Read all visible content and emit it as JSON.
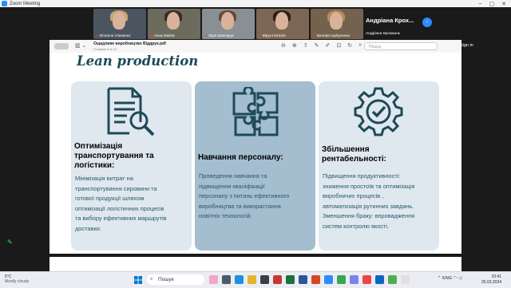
{
  "window": {
    "app_title": "Zoom Meeting"
  },
  "participants": [
    {
      "name": "Віталіна Ульванко",
      "bg": "#4a5560",
      "hair": "#c9a571"
    },
    {
      "name": "Анна Майов",
      "bg": "#6d6a5e",
      "hair": "#3b2a22"
    },
    {
      "name": "Лідія Шевчарук",
      "bg": "#8a8f93",
      "hair": "#6a4a34"
    },
    {
      "name": "Вірук Наталія",
      "bg": "#7c6656",
      "hair": "#2a1f1a"
    },
    {
      "name": "Валерія Цибуленко",
      "bg": "#74624f",
      "hair": "#b88a5a"
    }
  ],
  "current_user": {
    "big_name": "Андріана Крох...",
    "small_name": "Андріана Крохмаль"
  },
  "viewer": {
    "doc_title": "Ощадливе виробництво Віддрук.pdf",
    "page_info": "Сторінка 6 із 12",
    "search_placeholder": "Пошук",
    "sign_in": "Sign in"
  },
  "slide": {
    "title": "Lean production",
    "cards": [
      {
        "heading": [
          "Оптимізація",
          "транспортування та",
          "логістики:"
        ],
        "body": [
          "Мінімізація витрат на",
          "транспортування сировини та",
          "готової продукції шляхом",
          "оптимізації логістичних процесів",
          "та вибору ефективних маршрутів",
          "доставки."
        ]
      },
      {
        "heading": [
          "Навчання персоналу:"
        ],
        "body": [
          "Проведення навчання та",
          "підвищення кваліфікації",
          "персоналу з питань ефективного",
          "виробництва та використання",
          "новітніх технологій."
        ]
      },
      {
        "heading": [
          "Збільшення",
          "рентабельності:"
        ],
        "body": [
          "Підвищення продуктивності:",
          "зниження простоїв та оптимізація",
          "виробничих процесів ,",
          "автоматизація рутинних завдань.",
          "Зменшення браку: впровадження",
          "систем контролю якості."
        ]
      }
    ],
    "accent_color": "#1e4a5a",
    "icon_color": "#1e4a5a"
  },
  "taskbar": {
    "weather_temp": "5°C",
    "weather_desc": "Mostly cloudy",
    "search_label": "Пошук",
    "lang": "ENG",
    "time": "10:41",
    "date": "26.03.2024"
  }
}
